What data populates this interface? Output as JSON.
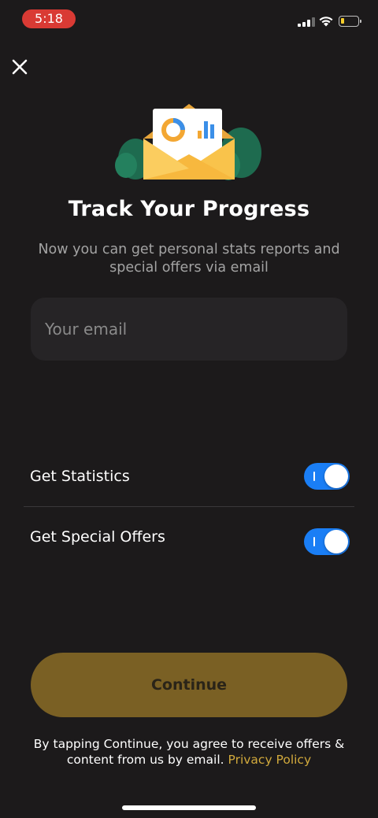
{
  "status_bar": {
    "time": "5:18",
    "icons": [
      "signal-icon",
      "wifi-icon",
      "battery-icon"
    ],
    "time_pill_color": "#d93a34",
    "battery_color": "#f5cd2c"
  },
  "header": {
    "close_icon": "close-icon"
  },
  "hero": {
    "title": "Track Your Progress",
    "subtitle": "Now you can get personal stats reports and special offers via email"
  },
  "email": {
    "placeholder": "Your email",
    "value": ""
  },
  "toggles": [
    {
      "label": "Get Statistics",
      "on": true
    },
    {
      "label": "Get Special Offers",
      "on": true
    }
  ],
  "cta": {
    "label": "Continue",
    "color": "#7a6024"
  },
  "legal": {
    "text": "By tapping Continue, you agree to receive offers & content from us by email.",
    "link": "Privacy Policy",
    "link_color": "#d1a93c"
  },
  "theme": {
    "background": "#1c1a1b",
    "accent": "#1a7ef5"
  }
}
